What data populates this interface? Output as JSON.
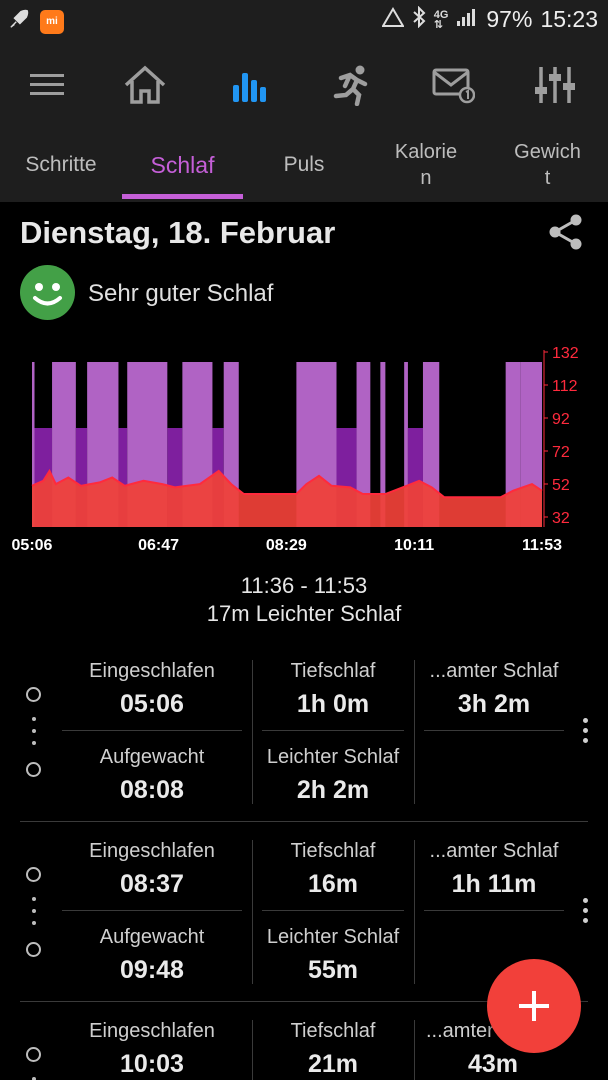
{
  "status_bar": {
    "battery": "97%",
    "time": "15:23",
    "network": "4G",
    "icons": [
      "rocket-icon",
      "mi-fit-icon",
      "signal-icon",
      "bluetooth-icon",
      "network-icon",
      "cell-signal-icon"
    ]
  },
  "app_bar": {
    "icons": [
      "menu-icon",
      "home-icon",
      "bar-chart-icon",
      "runner-icon",
      "mail-notification-icon",
      "equalizer-icon"
    ],
    "active_color": "#2196f3"
  },
  "tabs": [
    {
      "label": "Schritte"
    },
    {
      "label": "Schlaf"
    },
    {
      "label": "Puls"
    },
    {
      "label": "Kalorie\nn"
    },
    {
      "label": "Gewich\nt"
    }
  ],
  "colors": {
    "accent": "#c55fd8",
    "fab": "#f2403a",
    "good_sleep": "#43a047"
  },
  "header": {
    "date": "Dienstag, 18. Februar",
    "quality": "Sehr guter Schlaf"
  },
  "chart_data": {
    "type": "area",
    "x_tick_labels": [
      "05:06",
      "06:47",
      "08:29",
      "10:11",
      "11:53"
    ],
    "y_tick_labels": [
      "132",
      "112",
      "92",
      "72",
      "52",
      "32"
    ],
    "ylim": [
      32,
      132
    ],
    "colors": {
      "light": "#b063c4",
      "deep": "#7e1f9e",
      "heart": "#ff2a3d",
      "heart_area": "#ef4138"
    },
    "sleep_segments": [
      {
        "start": "05:06",
        "end": "05:08",
        "stage": "light"
      },
      {
        "start": "05:08",
        "end": "05:22",
        "stage": "deep"
      },
      {
        "start": "05:22",
        "end": "05:41",
        "stage": "light"
      },
      {
        "start": "05:41",
        "end": "05:50",
        "stage": "deep"
      },
      {
        "start": "05:50",
        "end": "06:15",
        "stage": "light"
      },
      {
        "start": "06:15",
        "end": "06:22",
        "stage": "deep"
      },
      {
        "start": "06:22",
        "end": "06:54",
        "stage": "light"
      },
      {
        "start": "06:54",
        "end": "07:06",
        "stage": "deep"
      },
      {
        "start": "07:06",
        "end": "07:30",
        "stage": "light"
      },
      {
        "start": "07:30",
        "end": "07:39",
        "stage": "deep"
      },
      {
        "start": "07:39",
        "end": "07:51",
        "stage": "light"
      },
      {
        "start": "08:37",
        "end": "09:09",
        "stage": "light"
      },
      {
        "start": "09:09",
        "end": "09:25",
        "stage": "deep"
      },
      {
        "start": "09:25",
        "end": "09:36",
        "stage": "light"
      },
      {
        "start": "09:44",
        "end": "09:48",
        "stage": "light"
      },
      {
        "start": "10:03",
        "end": "10:06",
        "stage": "light"
      },
      {
        "start": "10:06",
        "end": "10:18",
        "stage": "deep"
      },
      {
        "start": "10:18",
        "end": "10:31",
        "stage": "light"
      },
      {
        "start": "11:24",
        "end": "11:36",
        "stage": "light"
      },
      {
        "start": "11:36",
        "end": "11:53",
        "stage": "light"
      }
    ],
    "heart_rate": [
      {
        "t": "05:06",
        "bpm": 57
      },
      {
        "t": "05:15",
        "bpm": 60
      },
      {
        "t": "05:20",
        "bpm": 66
      },
      {
        "t": "05:25",
        "bpm": 58
      },
      {
        "t": "05:35",
        "bpm": 62
      },
      {
        "t": "05:45",
        "bpm": 57
      },
      {
        "t": "06:00",
        "bpm": 59
      },
      {
        "t": "06:10",
        "bpm": 62
      },
      {
        "t": "06:20",
        "bpm": 57
      },
      {
        "t": "06:35",
        "bpm": 60
      },
      {
        "t": "06:50",
        "bpm": 58
      },
      {
        "t": "07:00",
        "bpm": 56
      },
      {
        "t": "07:20",
        "bpm": 58
      },
      {
        "t": "07:35",
        "bpm": 66
      },
      {
        "t": "07:45",
        "bpm": 58
      },
      {
        "t": "07:55",
        "bpm": 52
      },
      {
        "t": "08:20",
        "bpm": 52
      },
      {
        "t": "08:37",
        "bpm": 52
      },
      {
        "t": "08:45",
        "bpm": 58
      },
      {
        "t": "08:55",
        "bpm": 63
      },
      {
        "t": "09:05",
        "bpm": 57
      },
      {
        "t": "09:20",
        "bpm": 56
      },
      {
        "t": "09:30",
        "bpm": 52
      },
      {
        "t": "09:48",
        "bpm": 52
      },
      {
        "t": "10:05",
        "bpm": 57
      },
      {
        "t": "10:15",
        "bpm": 60
      },
      {
        "t": "10:25",
        "bpm": 56
      },
      {
        "t": "10:35",
        "bpm": 50
      },
      {
        "t": "11:20",
        "bpm": 50
      },
      {
        "t": "11:30",
        "bpm": 54
      },
      {
        "t": "11:45",
        "bpm": 58
      },
      {
        "t": "11:53",
        "bpm": 54
      }
    ]
  },
  "selection": {
    "time_range": "11:36 - 11:53",
    "description": "17m Leichter Schlaf"
  },
  "sessions": [
    {
      "asleep_label": "Eingeschlafen",
      "asleep": "05:06",
      "deep_label": "Tiefschlaf",
      "deep": "1h 0m",
      "total_label": "...amter Schlaf",
      "total": "3h 2m",
      "woke_label": "Aufgewacht",
      "woke": "08:08",
      "light_label": "Leichter Schlaf",
      "light": "2h 2m"
    },
    {
      "asleep_label": "Eingeschlafen",
      "asleep": "08:37",
      "deep_label": "Tiefschlaf",
      "deep": "16m",
      "total_label": "...amter Schlaf",
      "total": "1h 11m",
      "woke_label": "Aufgewacht",
      "woke": "09:48",
      "light_label": "Leichter Schlaf",
      "light": "55m"
    },
    {
      "asleep_label": "Eingeschlafen",
      "asleep": "10:03",
      "deep_label": "Tiefschlaf",
      "deep": "21m",
      "total_label": "...amter",
      "total": "43m"
    }
  ],
  "fab": {
    "icon": "plus-icon"
  }
}
